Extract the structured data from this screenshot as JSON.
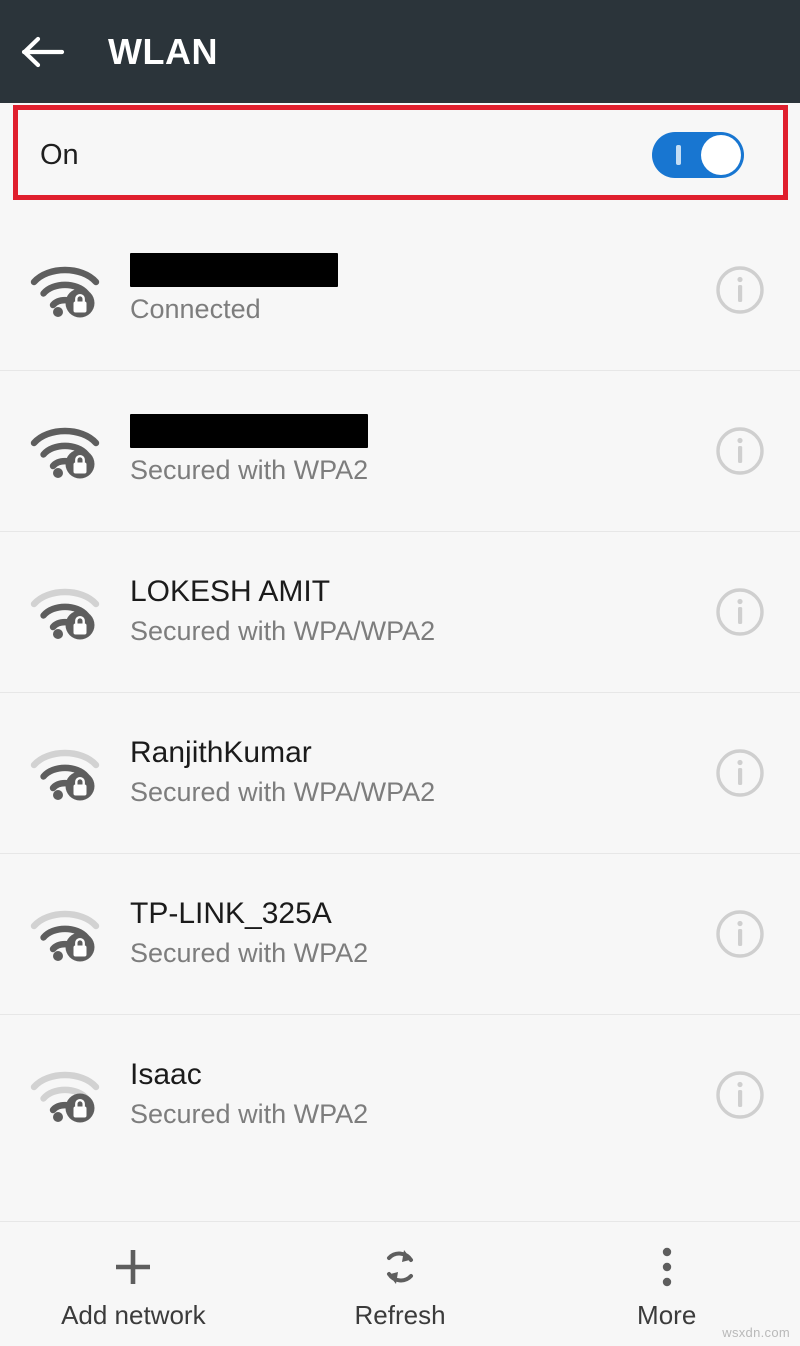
{
  "header": {
    "title": "WLAN",
    "back_icon": "arrow-left-icon",
    "background_color": "#2b343a",
    "text_color": "#ffffff"
  },
  "wifi_toggle": {
    "label": "On",
    "state": "on",
    "accent_color": "#1876d1",
    "highlight_color": "#e01f2e",
    "highlighted": true
  },
  "networks": [
    {
      "ssid": "",
      "redacted": true,
      "redacted_width": 208,
      "status": "Connected",
      "signal_icon": "wifi-lock-icon",
      "signal_bars": 3,
      "info_icon": "info-circle-icon"
    },
    {
      "ssid": "",
      "redacted": true,
      "redacted_width": 238,
      "status": "Secured with WPA2",
      "signal_icon": "wifi-lock-icon",
      "signal_bars": 3,
      "info_icon": "info-circle-icon"
    },
    {
      "ssid": "LOKESH AMIT",
      "redacted": false,
      "status": "Secured with WPA/WPA2",
      "signal_icon": "wifi-lock-icon",
      "signal_bars": 2,
      "info_icon": "info-circle-icon"
    },
    {
      "ssid": "RanjithKumar",
      "redacted": false,
      "status": "Secured with WPA/WPA2",
      "signal_icon": "wifi-lock-icon",
      "signal_bars": 2,
      "info_icon": "info-circle-icon"
    },
    {
      "ssid": "TP-LINK_325A",
      "redacted": false,
      "status": "Secured with WPA2",
      "signal_icon": "wifi-lock-icon",
      "signal_bars": 2,
      "info_icon": "info-circle-icon"
    },
    {
      "ssid": "Isaac",
      "redacted": false,
      "status": "Secured with WPA2",
      "signal_icon": "wifi-lock-icon",
      "signal_bars": 1,
      "info_icon": "info-circle-icon"
    }
  ],
  "toolbar": {
    "items": [
      {
        "label": "Add network",
        "icon": "plus-icon"
      },
      {
        "label": "Refresh",
        "icon": "refresh-icon"
      },
      {
        "label": "More",
        "icon": "overflow-menu-icon"
      }
    ]
  },
  "watermark": "wsxdn.com"
}
